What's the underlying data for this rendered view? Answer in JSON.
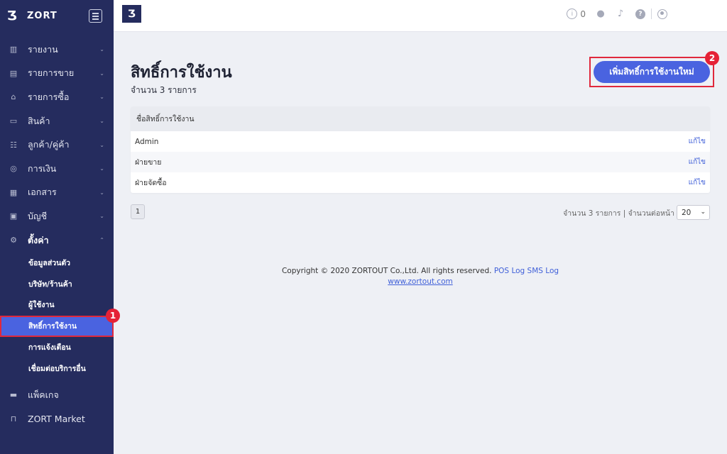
{
  "sidebar": {
    "brand": "ZORT",
    "items": [
      {
        "label": "รายงาน",
        "icon": "bar-chart-icon"
      },
      {
        "label": "รายการขาย",
        "icon": "clipboard-icon"
      },
      {
        "label": "รายการซื้อ",
        "icon": "basket-icon"
      },
      {
        "label": "สินค้า",
        "icon": "box-icon"
      },
      {
        "label": "ลูกค้า/คู่ค้า",
        "icon": "users-icon"
      },
      {
        "label": "การเงิน",
        "icon": "coin-icon"
      },
      {
        "label": "เอกสาร",
        "icon": "document-icon"
      },
      {
        "label": "บัญชี",
        "icon": "ledger-icon"
      },
      {
        "label": "ตั้งค่า",
        "icon": "gear-icon"
      }
    ],
    "submenu": [
      "ข้อมูลส่วนตัว",
      "บริษัท/ร้านค้า",
      "ผู้ใช้งาน",
      "สิทธิ์การใช้งาน",
      "การแจ้งเตือน",
      "เชื่อมต่อบริการอื่น"
    ],
    "bottom": [
      {
        "label": "แพ็คเกจ",
        "icon": "briefcase-icon"
      },
      {
        "label": "ZORT Market",
        "icon": "bag-icon"
      }
    ],
    "badge1": "1"
  },
  "topbar": {
    "info_count": "0"
  },
  "main": {
    "title": "สิทธิ์การใช้งาน",
    "subtitle": "จำนวน 3 รายการ",
    "add_button": "เพิ่มสิทธิ์การใช้งานใหม่",
    "badge2": "2",
    "table": {
      "header": "ชื่อสิทธิ์การใช้งาน",
      "rows": [
        "Admin",
        "ฝ่ายขาย",
        "ฝ่ายจัดซื้อ"
      ],
      "edit_label": "แก้ไข"
    },
    "pager": {
      "page": "1",
      "info": "จำนวน 3 รายการ | จำนวนต่อหน้า",
      "per_page": "20"
    }
  },
  "footer": {
    "copyright": "Copyright © 2020 ZORTOUT Co.,Ltd. All rights reserved.",
    "pos": "POS",
    "log": "Log",
    "sms_log": "SMS Log",
    "site": "www.zortout.com"
  },
  "colors": {
    "sidebar": "#252c5e",
    "accent": "#4a63e0",
    "highlight": "#e0283c"
  }
}
